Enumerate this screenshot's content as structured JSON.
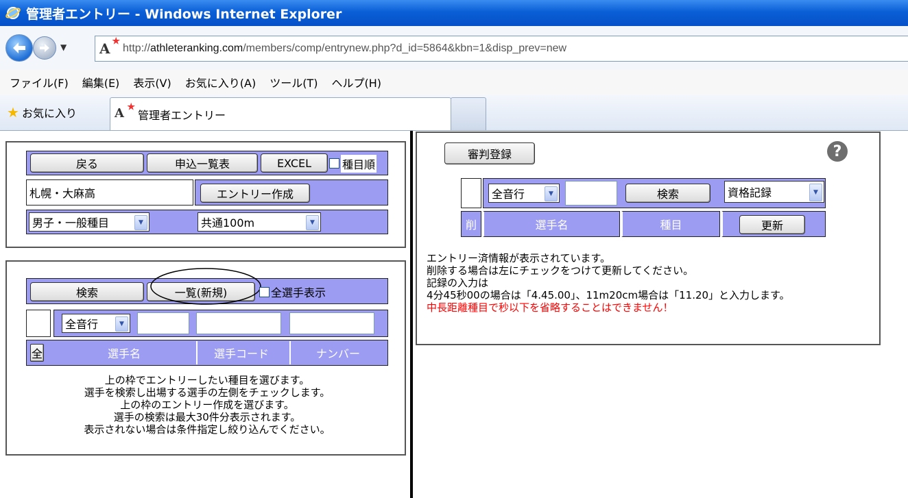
{
  "window": {
    "title": "管理者エントリー - Windows Internet Explorer"
  },
  "address": {
    "url_prefix": "http://",
    "url_host": "athleteranking.com",
    "url_path": "/members/comp/entrynew.php?d_id=5864&kbn=1&disp_prev=new"
  },
  "menu": [
    "ファイル(F)",
    "編集(E)",
    "表示(V)",
    "お気に入り(A)",
    "ツール(T)",
    "ヘルプ(H)"
  ],
  "favorites": {
    "label": "お気に入り",
    "tab_title": "管理者エントリー"
  },
  "site_icon_text": "A",
  "left_top": {
    "back_button": "戻る",
    "list_button": "申込一覧表",
    "excel_button": "EXCEL",
    "event_order_label": "種目順",
    "school_name": "札幌・大麻高",
    "create_entry_button": "エントリー作成",
    "category_select": "男子・一般種目",
    "event_select": "共通100m"
  },
  "left_bottom": {
    "search_button": "検索",
    "list_new_button": "一覧(新規)",
    "show_all_label": "全選手表示",
    "kana_select": "全音行",
    "all_button": "全",
    "headers": [
      "選手名",
      "選手コード",
      "ナンバー"
    ],
    "instructions": [
      "上の枠でエントリーしたい種目を選びます。",
      "選手を検索し出場する選手の左側をチェックします。",
      "上の枠のエントリー作成を選びます。",
      "選手の検索は最大30件分表示されます。",
      "表示されない場合は条件指定し絞り込んでください。"
    ]
  },
  "right": {
    "judge_button": "審判登録",
    "help_icon": "?",
    "kana_select": "全音行",
    "search_button": "検索",
    "record_select": "資格記録",
    "headers": {
      "delete": "削",
      "name": "選手名",
      "event": "種目"
    },
    "update_button": "更新",
    "info": [
      "エントリー済情報が表示されています。",
      "削除する場合は左にチェックをつけて更新してください。",
      "記録の入力は",
      "4分45秒00の場合は「4.45.00」、11m20cm場合は「11.20」と入力します。"
    ],
    "warning": "中長距離種目で秒以下を省略することはできません！",
    "warning_color": "#ff0000"
  },
  "colors": {
    "header_purple": "#9c9cf2",
    "titlebar_blue": "#0a5fd6"
  }
}
